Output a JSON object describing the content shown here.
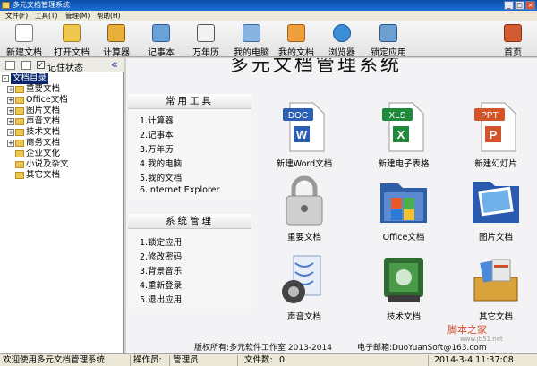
{
  "window": {
    "title": "多元文档管理系统"
  },
  "menu": [
    "文件(F)",
    "工具(T)",
    "管理(M)",
    "帮助(H)"
  ],
  "toolbar": [
    {
      "label": "新建文档",
      "icon": "new-document-icon"
    },
    {
      "label": "打开文档",
      "icon": "open-document-icon"
    },
    {
      "label": "计算器",
      "icon": "calculator-icon"
    },
    {
      "label": "记事本",
      "icon": "notepad-icon"
    },
    {
      "label": "万年历",
      "icon": "calendar-icon"
    },
    {
      "label": "我的电脑",
      "icon": "computer-icon"
    },
    {
      "label": "我的文档",
      "icon": "documents-icon"
    },
    {
      "label": "浏览器",
      "icon": "browser-icon"
    },
    {
      "label": "锁定应用",
      "icon": "lock-icon"
    },
    {
      "label": "首页",
      "icon": "home-icon"
    }
  ],
  "left": {
    "remember_label": "记住状态",
    "remember_checked": true,
    "tree_root": "文档目录",
    "tree": [
      "重要文档",
      "Office文档",
      "图片文档",
      "声音文档",
      "技术文档",
      "商务文档",
      "企业文化",
      "小说及杂文",
      "其它文档"
    ]
  },
  "main": {
    "title": "多元文档管理系统",
    "common_tools": {
      "header": "常用工具",
      "items": [
        "1.计算器",
        "2.记事本",
        "3.万年历",
        "4.我的电脑",
        "5.我的文档",
        "6.Internet Explorer"
      ]
    },
    "system_mgmt": {
      "header": "系统管理",
      "items": [
        "1.锁定应用",
        "2.修改密码",
        "3.背景音乐",
        "4.重新登录",
        "5.退出应用"
      ]
    },
    "icons": [
      {
        "label": "新建Word文档",
        "badge": "DOC",
        "color": "#2b5fb4"
      },
      {
        "label": "新建电子表格",
        "badge": "XLS",
        "color": "#1f8a3a"
      },
      {
        "label": "新建幻灯片",
        "badge": "PPT",
        "color": "#d2552a"
      },
      {
        "label": "重要文档",
        "icon": "lock-icon"
      },
      {
        "label": "Office文档",
        "icon": "office-folder-icon"
      },
      {
        "label": "图片文档",
        "icon": "pictures-icon"
      },
      {
        "label": "声音文档",
        "icon": "sound-icon"
      },
      {
        "label": "技术文档",
        "icon": "tech-icon"
      },
      {
        "label": "其它文档",
        "icon": "other-icon"
      }
    ],
    "copyright": "版权所有:多元软件工作室 2013-2014",
    "email": "电子邮箱:DuoYuanSoft@163.com"
  },
  "status": {
    "welcome": "欢迎使用多元文档管理系统",
    "operator": "操作员:",
    "operator_name": "管理员",
    "file_count_label": "文件数:",
    "file_count": "0",
    "datetime": "2014-3-4 11:37:08"
  },
  "watermark": {
    "text": "脚本之家",
    "url": "www.jb51.net"
  }
}
